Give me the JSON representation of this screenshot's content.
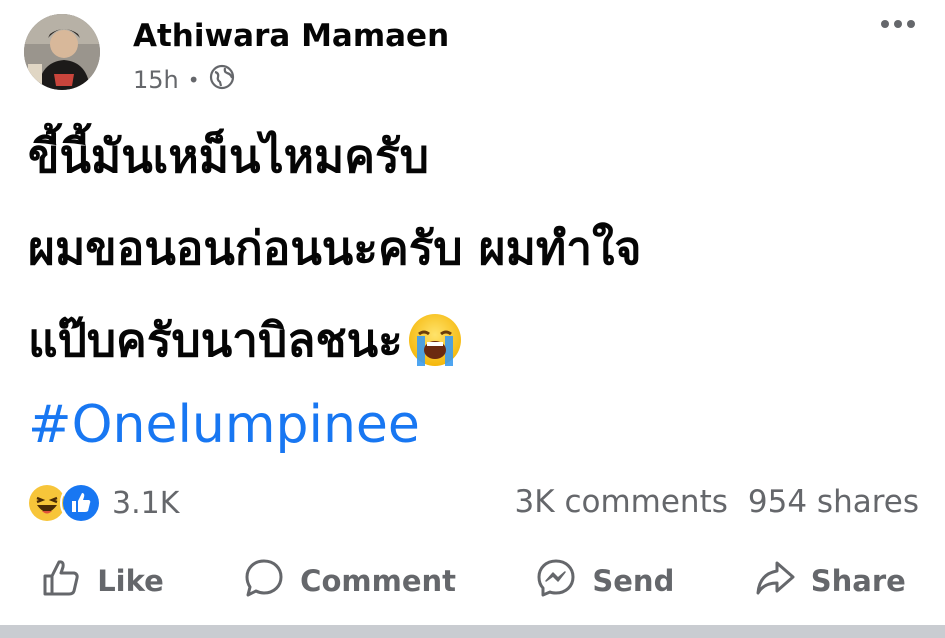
{
  "post": {
    "author": "Athiwara Mamaen",
    "time": "15h",
    "privacy_icon": "globe-icon",
    "body_lines": [
      "ขี้นี้มันเหม็นไหมครับ",
      "ผมขอนอนก่อนนะครับ ผมทำใจ",
      "แป๊บครับนาบิลชนะ"
    ],
    "body_emoji": "loudly-crying-face",
    "hashtag": "#Onelumpinee"
  },
  "reactions": {
    "icons": [
      "haha-reaction",
      "like-reaction"
    ],
    "count": "3.1K"
  },
  "stats": {
    "comments": "3K comments",
    "shares": "954 shares"
  },
  "actions": {
    "like": "Like",
    "comment": "Comment",
    "send": "Send",
    "share": "Share"
  },
  "colors": {
    "hashtag": "#1877f2",
    "muted": "#65676b",
    "text": "#050505"
  }
}
